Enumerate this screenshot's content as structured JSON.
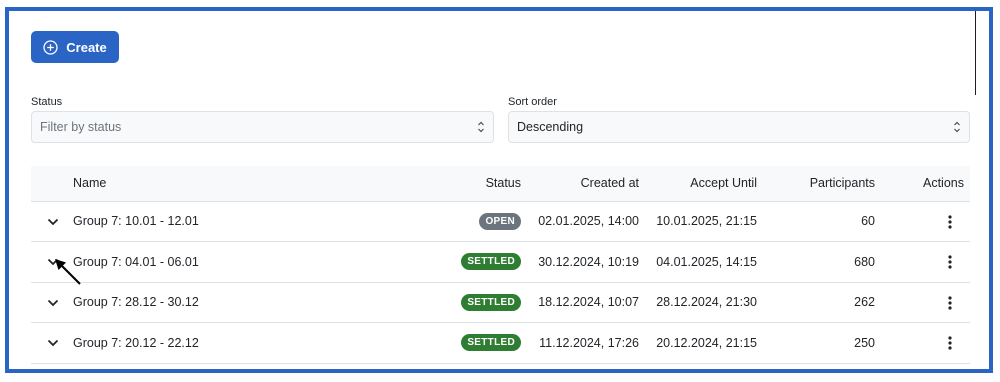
{
  "toolbar": {
    "create_label": "Create"
  },
  "filters": {
    "status": {
      "label": "Status",
      "placeholder": "Filter by status"
    },
    "sort": {
      "label": "Sort order",
      "value": "Descending"
    }
  },
  "table": {
    "headers": {
      "name": "Name",
      "status": "Status",
      "created_at": "Created at",
      "accept_until": "Accept Until",
      "participants": "Participants",
      "actions": "Actions"
    },
    "rows": [
      {
        "name": "Group 7: 10.01 - 12.01",
        "status": "OPEN",
        "created_at": "02.01.2025, 14:00",
        "accept_until": "10.01.2025, 21:15",
        "participants": "60"
      },
      {
        "name": "Group 7: 04.01 - 06.01",
        "status": "SETTLED",
        "created_at": "30.12.2024, 10:19",
        "accept_until": "04.01.2025, 14:15",
        "participants": "680"
      },
      {
        "name": "Group 7: 28.12 - 30.12",
        "status": "SETTLED",
        "created_at": "18.12.2024, 10:07",
        "accept_until": "28.12.2024, 21:30",
        "participants": "262"
      },
      {
        "name": "Group 7: 20.12 - 22.12",
        "status": "SETTLED",
        "created_at": "11.12.2024, 17:26",
        "accept_until": "20.12.2024, 21:15",
        "participants": "250"
      }
    ]
  },
  "colors": {
    "accent": "#2a64c4",
    "badge_open": "#6c757d",
    "badge_settled": "#2e7d32"
  },
  "icons": {
    "create": "plus-circle-icon",
    "expand": "chevron-down-icon",
    "actions": "kebab-menu-icon",
    "select_caret": "sort-caret-icon",
    "cursor": "mouse-pointer-icon"
  }
}
